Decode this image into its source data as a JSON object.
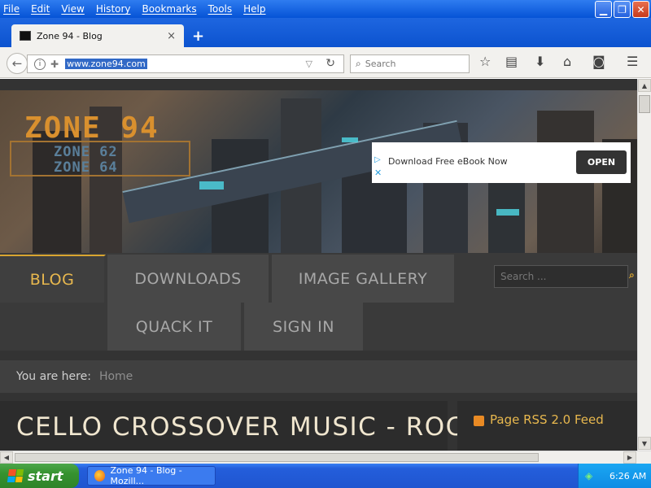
{
  "menu": [
    "File",
    "Edit",
    "View",
    "History",
    "Bookmarks",
    "Tools",
    "Help"
  ],
  "window_controls": {
    "minimize_icon": "minimize-icon",
    "restore_icon": "restore-icon",
    "close_icon": "close-icon"
  },
  "tab": {
    "title": "Zone 94 - Blog",
    "close": "×"
  },
  "newtab": "+",
  "url": "www.zone94.com",
  "search_placeholder": "Search",
  "site": {
    "logo": {
      "main": "ZONE 94",
      "sub1": "ZONE 62",
      "sub2": "ZONE 64"
    },
    "ad": {
      "text": "Download Free eBook Now",
      "button": "OPEN"
    },
    "nav": {
      "blog": "BLOG",
      "downloads": "DOWNLOADS",
      "gallery": "IMAGE GALLERY",
      "quack": "QUACK IT",
      "signin": "SIGN IN"
    },
    "search_placeholder": "Search ...",
    "breadcrumb": {
      "label": "You are here:",
      "home": "Home"
    },
    "article_title": "CELLO CROSSOVER MUSIC - ROCK AND",
    "sidebar_feed": "Page RSS 2.0 Feed"
  },
  "taskbar": {
    "start": "start",
    "task": "Zone 94 - Blog - Mozill...",
    "clock": "6:26 AM"
  },
  "colors": {
    "xp_blue": "#0553d6",
    "accent_gold": "#e8b84e",
    "site_dark": "#333333"
  }
}
